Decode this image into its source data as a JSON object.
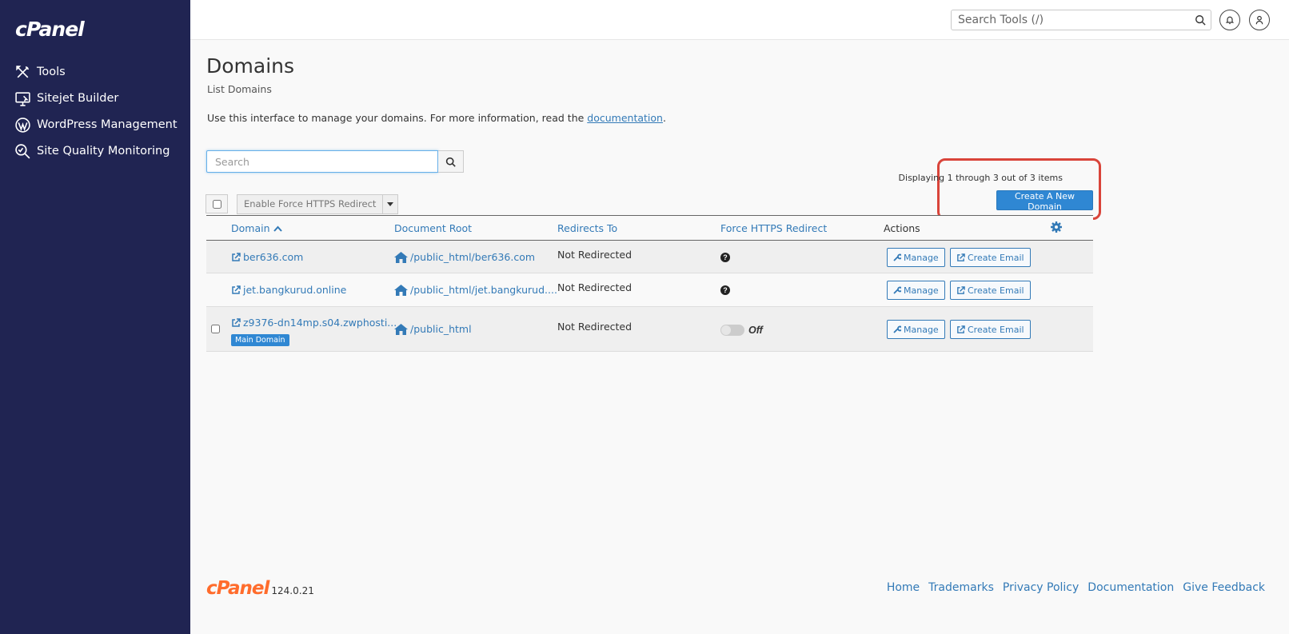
{
  "sidebar": {
    "logo": "cPanel",
    "items": [
      {
        "label": "Tools",
        "icon": "tools-icon"
      },
      {
        "label": "Sitejet Builder",
        "icon": "monitor-icon"
      },
      {
        "label": "WordPress Management",
        "icon": "wordpress-icon"
      },
      {
        "label": "Site Quality Monitoring",
        "icon": "magnifier-check-icon"
      }
    ]
  },
  "topbar": {
    "search_placeholder": "Search Tools (/)"
  },
  "page": {
    "title": "Domains",
    "subtitle": "List Domains",
    "intro_text": "Use this interface to manage your domains. For more information, read the ",
    "intro_link": "documentation",
    "intro_end": "."
  },
  "domain_search": {
    "placeholder": "Search"
  },
  "bulk": {
    "action_label": "Enable Force HTTPS Redirect"
  },
  "display_count": "Displaying 1 through 3 out of 3 items",
  "create_button": "Create A New Domain",
  "table": {
    "headers": {
      "domain": "Domain",
      "document_root": "Document Root",
      "redirects_to": "Redirects To",
      "force_https": "Force HTTPS Redirect",
      "actions": "Actions"
    },
    "rows": [
      {
        "domain": "ber636.com",
        "document_root": "/public_html/ber636.com",
        "redirects_to": "Not Redirected",
        "force_https": "help",
        "manage": "Manage",
        "create_email": "Create Email"
      },
      {
        "domain": "jet.bangkurud.online",
        "document_root": "/public_html/jet.bangkurud....",
        "redirects_to": "Not Redirected",
        "force_https": "help",
        "manage": "Manage",
        "create_email": "Create Email"
      },
      {
        "domain": "z9376-dn14mp.s04.zwphosti...",
        "document_root": "/public_html",
        "redirects_to": "Not Redirected",
        "force_https": "Off",
        "badge": "Main Domain",
        "manage": "Manage",
        "create_email": "Create Email"
      }
    ]
  },
  "footer": {
    "brand": "cPanel",
    "version": "124.0.21",
    "links": [
      "Home",
      "Trademarks",
      "Privacy Policy",
      "Documentation",
      "Give Feedback"
    ]
  },
  "colors": {
    "sidebar": "#202452",
    "accent": "#2f87d3",
    "link": "#337ab7",
    "brand_orange": "#ff6c2c",
    "highlight": "#d9443a"
  }
}
